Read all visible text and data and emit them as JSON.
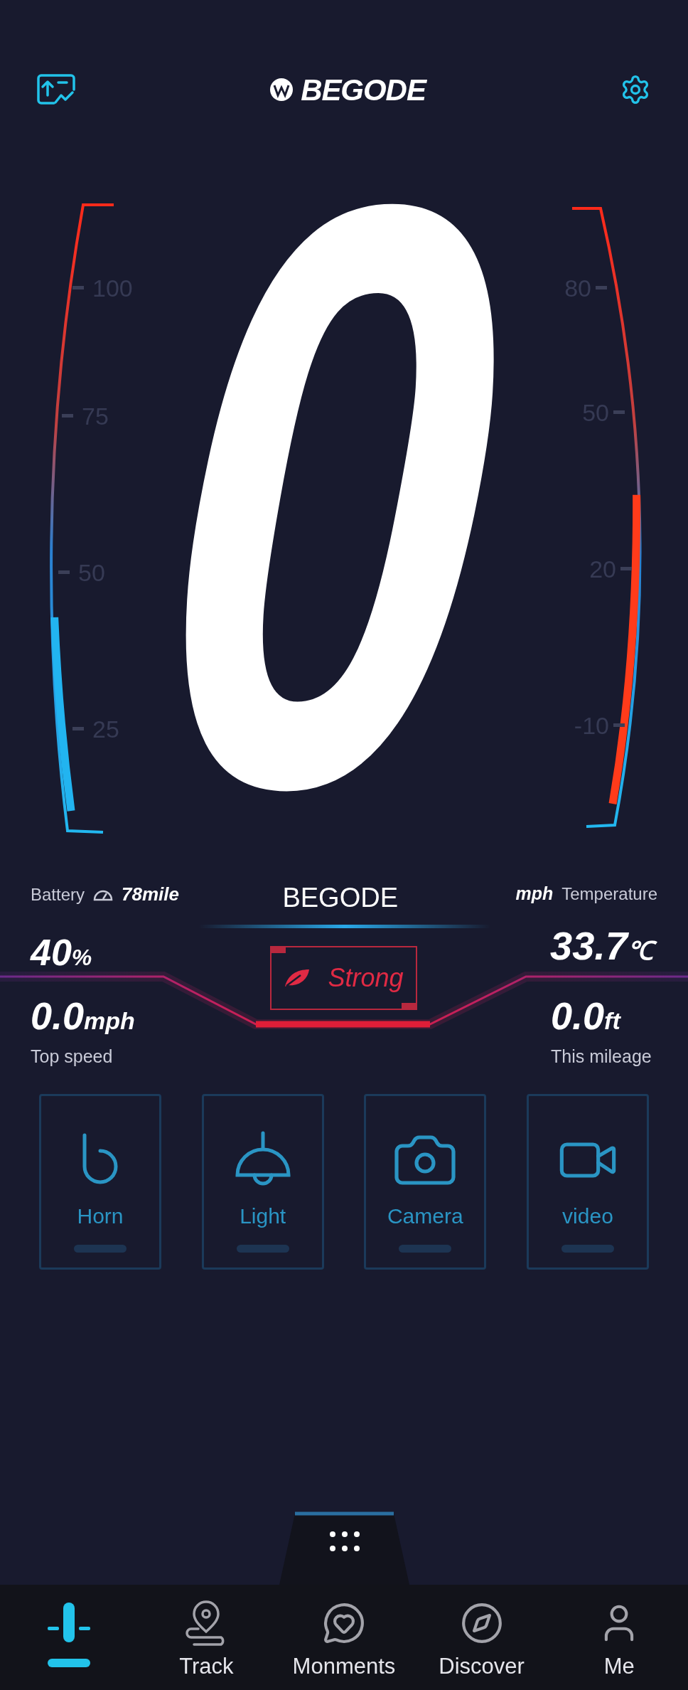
{
  "header": {
    "brand": "BEGODE"
  },
  "speed": {
    "value": "0"
  },
  "left_gauge": {
    "ticks": [
      "100",
      "75",
      "50",
      "25"
    ]
  },
  "right_gauge": {
    "ticks": [
      "80",
      "50",
      "20",
      "-10"
    ]
  },
  "stats": {
    "battery_label": "Battery",
    "range": "78mile",
    "battery_value": "40",
    "battery_unit": "%",
    "center_title": "BEGODE",
    "speed_unit": "mph",
    "temperature_label": "Temperature",
    "temperature_value": "33.7",
    "temperature_unit": "℃",
    "top_speed_value": "0.0",
    "top_speed_unit": "mph",
    "top_speed_label": "Top speed",
    "mileage_value": "0.0",
    "mileage_unit": "ft",
    "mileage_label": "This mileage"
  },
  "mode": {
    "label": "Strong"
  },
  "controls": [
    {
      "label": "Horn"
    },
    {
      "label": "Light"
    },
    {
      "label": "Camera"
    },
    {
      "label": "video"
    }
  ],
  "nav": [
    {
      "selected": true
    },
    {
      "label": "Track",
      "selected": false
    },
    {
      "label": "Monments",
      "selected": false
    },
    {
      "label": "Discover",
      "selected": false
    },
    {
      "label": "Me",
      "selected": false
    }
  ]
}
